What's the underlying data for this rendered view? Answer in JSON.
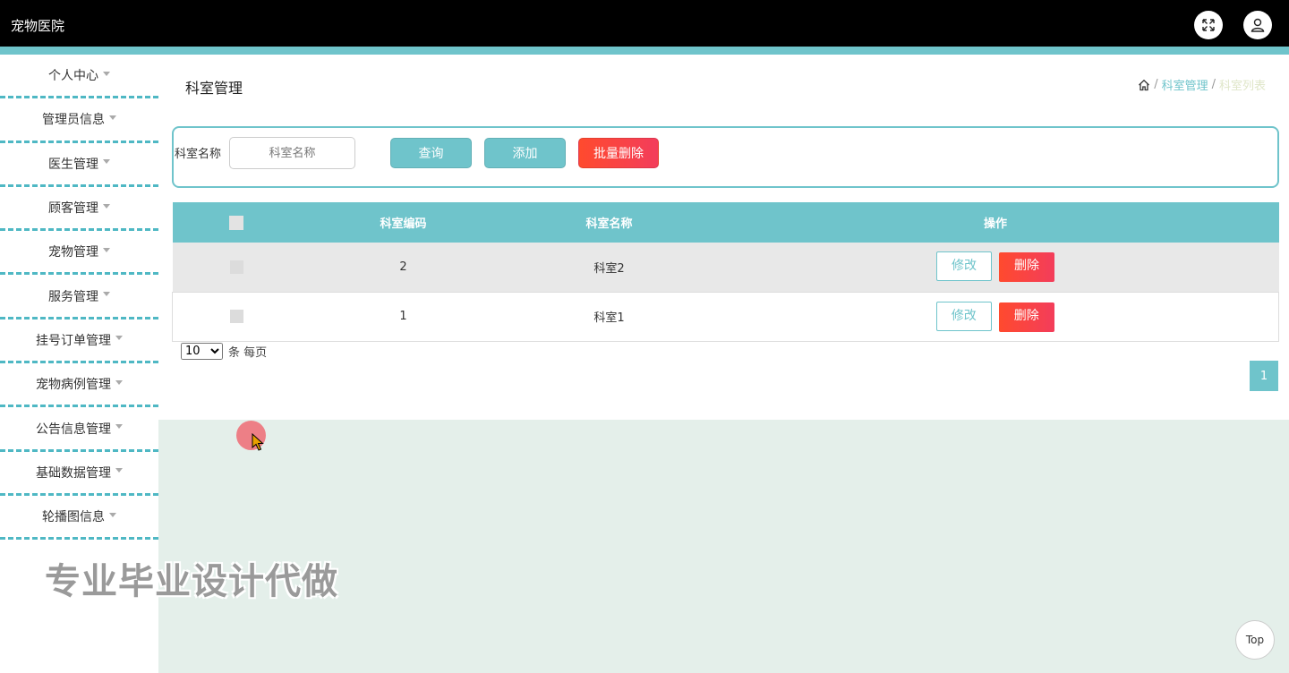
{
  "app": {
    "title": "宠物医院"
  },
  "sidebar": {
    "items": [
      {
        "label": "个人中心"
      },
      {
        "label": "管理员信息"
      },
      {
        "label": "医生管理"
      },
      {
        "label": "顾客管理"
      },
      {
        "label": "宠物管理"
      },
      {
        "label": "服务管理"
      },
      {
        "label": "挂号订单管理"
      },
      {
        "label": "宠物病例管理"
      },
      {
        "label": "公告信息管理"
      },
      {
        "label": "基础数据管理"
      },
      {
        "label": "轮播图信息"
      }
    ]
  },
  "page": {
    "title": "科室管理",
    "breadcrumb": {
      "sep": "/",
      "section": "科室管理",
      "current": "科室列表"
    }
  },
  "search": {
    "label": "科室名称",
    "placeholder": "科室名称",
    "query_label": "查询",
    "add_label": "添加",
    "batch_delete_label": "批量删除"
  },
  "table": {
    "headers": [
      "科室编码",
      "科室名称",
      "操作"
    ],
    "rows": [
      {
        "code": "2",
        "name": "科室2"
      },
      {
        "code": "1",
        "name": "科室1"
      }
    ],
    "edit_label": "修改",
    "delete_label": "删除"
  },
  "pagination": {
    "page_size": "10",
    "page_size_options": [
      "10"
    ],
    "suffix": "条 每页",
    "current_page": "1"
  },
  "watermark": "专业毕业设计代做",
  "top_button": "Top",
  "colors": {
    "accent": "#6fc4cb",
    "danger": "#ff4a2e",
    "topbar": "#000000"
  }
}
